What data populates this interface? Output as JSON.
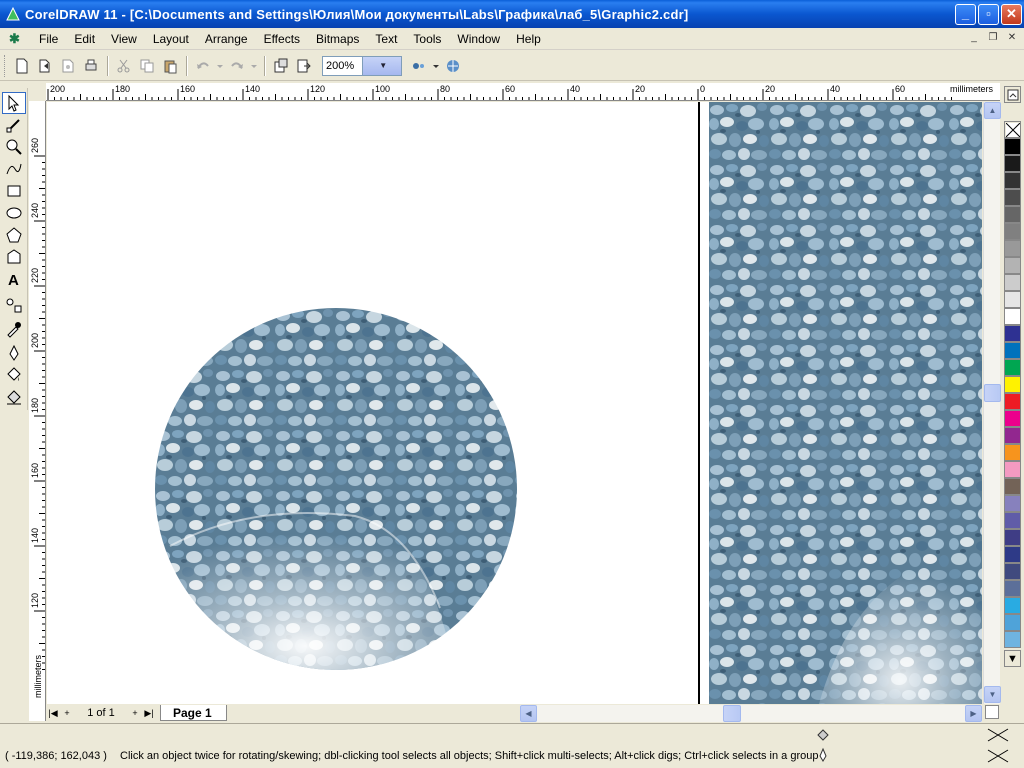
{
  "window": {
    "title": "CorelDRAW 11 - [C:\\Documents and Settings\\Юлия\\Мои документы\\Labs\\Графика\\лаб_5\\Graphic2.cdr]",
    "controls": [
      "minimize",
      "restore",
      "close"
    ]
  },
  "menubar": {
    "items": [
      "File",
      "Edit",
      "View",
      "Layout",
      "Arrange",
      "Effects",
      "Bitmaps",
      "Text",
      "Tools",
      "Window",
      "Help"
    ]
  },
  "toolbar": {
    "zoom_value": "200%"
  },
  "rulers": {
    "units": "millimeters",
    "horizontal_ticks": [
      "200",
      "180",
      "160",
      "140",
      "120",
      "100",
      "80",
      "60",
      "40",
      "20",
      "0",
      "20",
      "40",
      "60"
    ],
    "vertical_ticks": [
      "260",
      "240",
      "220",
      "200",
      "180",
      "160",
      "140",
      "120"
    ]
  },
  "page_nav": {
    "count": "1 of 1",
    "tab_label": "Page 1"
  },
  "palette": {
    "colors": [
      "#000000",
      "#1a1a1a",
      "#333333",
      "#4d4d4d",
      "#666666",
      "#808080",
      "#999999",
      "#b3b3b3",
      "#cccccc",
      "#e6e6e6",
      "#ffffff",
      "#2e3192",
      "#0072bc",
      "#00a651",
      "#fff200",
      "#ed1c24",
      "#ec008c",
      "#92278f",
      "#f7941d",
      "#f49ac1",
      "#736357",
      "#8781bd",
      "#605ca8",
      "#3f3d85",
      "#2e3a87",
      "#404a7e",
      "#5c6f99",
      "#29abe2",
      "#4fa3d9",
      "#6fb4e0"
    ]
  },
  "status": {
    "coords": "( -119,386; 162,043 )",
    "message": "Click an object twice for rotating/skewing; dbl-clicking tool selects all objects; Shift+click multi-selects; Alt+click digs; Ctrl+click selects in a group"
  }
}
